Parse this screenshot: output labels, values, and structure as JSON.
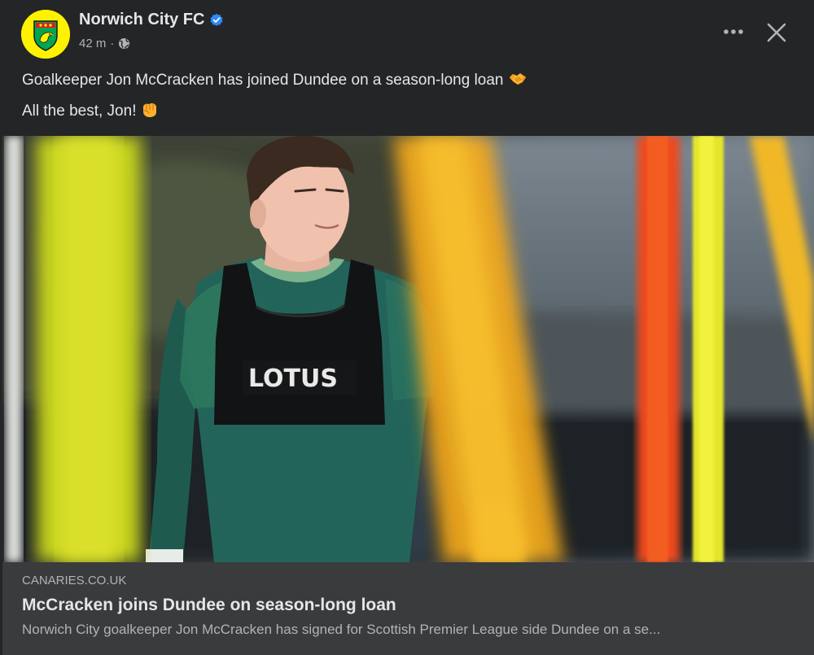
{
  "post": {
    "page_name": "Norwich City FC",
    "time": "42 m",
    "separator": "·",
    "verified_icon": "verified-badge-icon",
    "audience_icon": "globe-icon",
    "more_icon": "more-horizontal-icon",
    "close_icon": "close-icon",
    "text_lines": [
      "Goalkeeper Jon McCracken has joined Dundee on a season-long loan",
      "All the best, Jon!"
    ],
    "emojis": [
      "handshake-emoji",
      "fist-bump-emoji"
    ]
  },
  "image": {
    "bib_sponsor": "LOTUS"
  },
  "link_preview": {
    "domain": "CANARIES.CO.UK",
    "title": "McCracken joins Dundee on season-long loan",
    "description": "Norwich City goalkeeper Jon McCracken has signed for Scottish Premier League side Dundee on a se..."
  },
  "colors": {
    "background": "#242526",
    "card": "#3a3b3c",
    "text_primary": "#e4e6eb",
    "text_secondary": "#b0b3b8",
    "verified": "#2d88ff",
    "club_yellow": "#fff200",
    "club_green": "#00a650"
  }
}
